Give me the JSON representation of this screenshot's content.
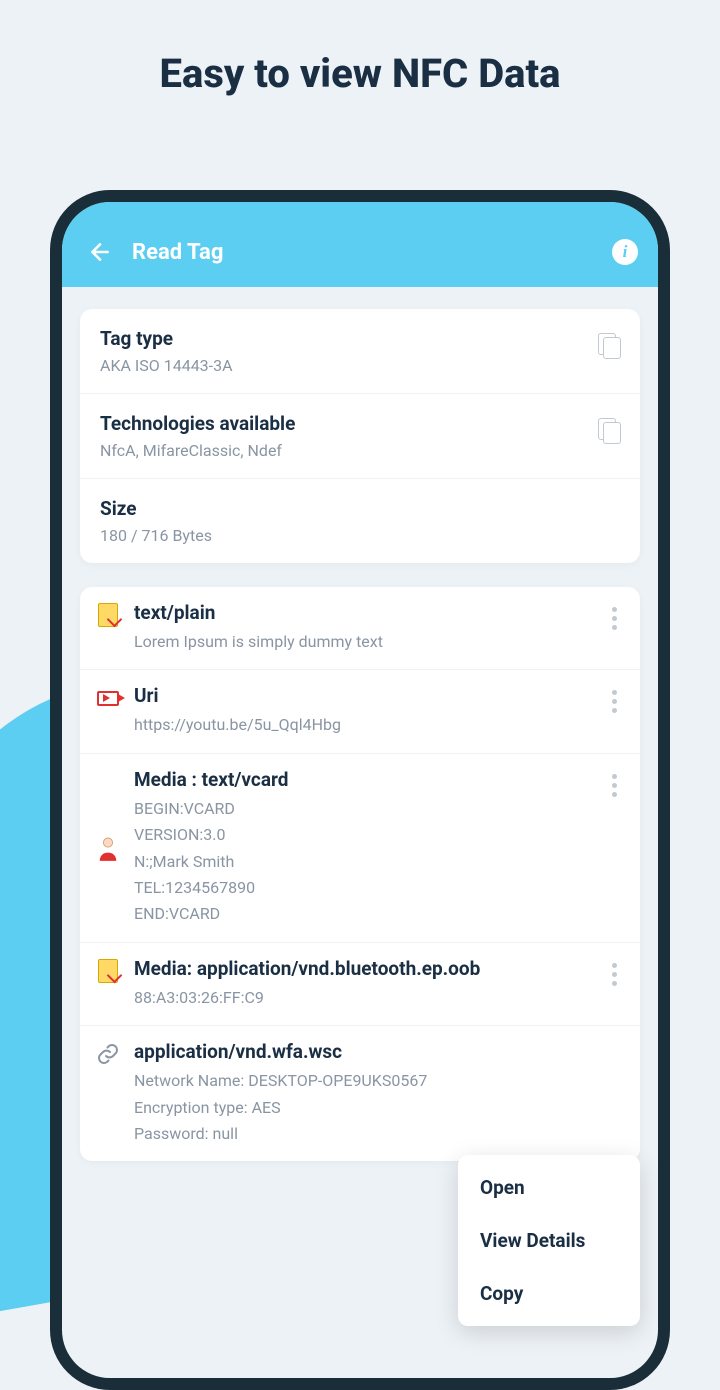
{
  "headline": "Easy to view NFC Data",
  "topbar": {
    "title": "Read Tag"
  },
  "info": {
    "tag_type_label": "Tag type",
    "tag_type_value": "AKA ISO 14443-3A",
    "tech_label": "Technologies available",
    "tech_value": "NfcA, MifareClassic, Ndef",
    "size_label": "Size",
    "size_value": "180 / 716 Bytes"
  },
  "records": [
    {
      "title": "text/plain",
      "body": "Lorem Ipsum is simply dummy text"
    },
    {
      "title": "Uri",
      "body": "https://youtu.be/5u_Qql4Hbg"
    },
    {
      "title": "Media : text/vcard",
      "body": "BEGIN:VCARD\nVERSION:3.0\nN:;Mark Smith\nTEL:1234567890\nEND:VCARD"
    },
    {
      "title": "Media: application/vnd.bluetooth.ep.oob",
      "body": "88:A3:03:26:FF:C9"
    },
    {
      "title": "application/vnd.wfa.wsc",
      "body": "Network Name: DESKTOP-OPE9UKS0567\nEncryption type: AES\nPassword: null"
    }
  ],
  "menu": {
    "open": "Open",
    "details": "View Details",
    "copy": "Copy"
  }
}
